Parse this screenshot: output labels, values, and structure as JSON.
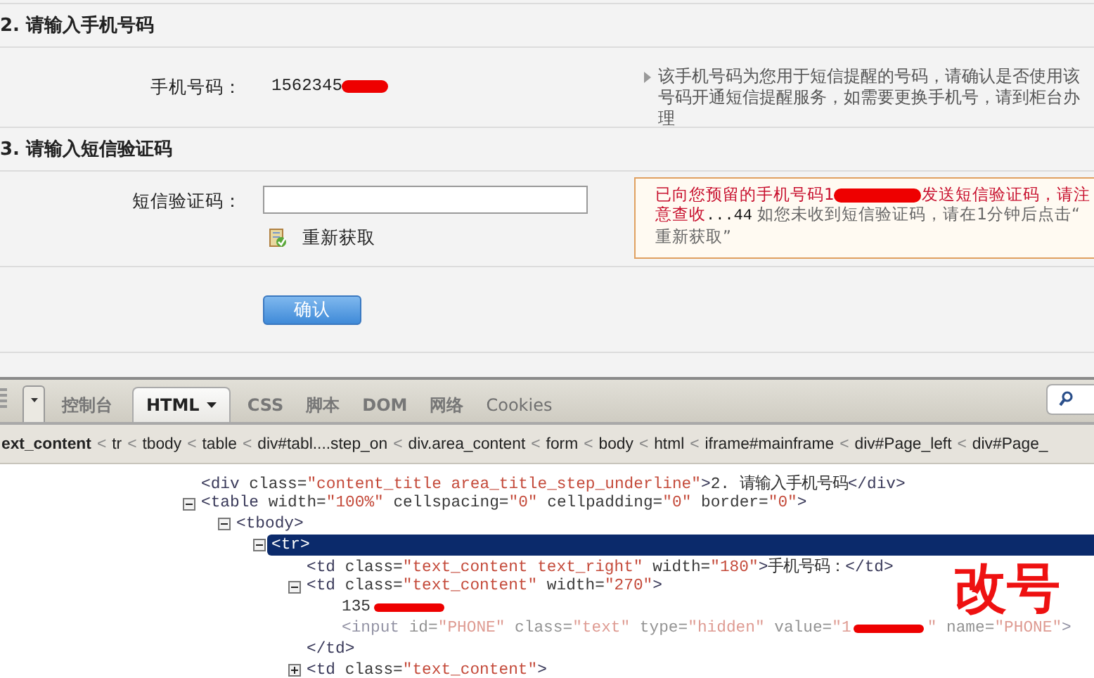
{
  "form": {
    "sections": [
      {
        "title": "2. 请输入手机号码"
      },
      {
        "title": "3. 请输入短信验证码"
      }
    ],
    "phone": {
      "label": "手机号码：",
      "value": [
        {
          "kind": "text",
          "text": "1562345"
        },
        {
          "kind": "redaction"
        }
      ],
      "hint": "该手机号码为您用于短信提醒的号码，请确认是否使用该号码开通短信提醒服务，如需要更换手机号，请到柜台办理"
    },
    "sms": {
      "label": "短信验证码：",
      "refresh": "重新获取",
      "message_lines": [
        [
          {
            "kind": "alert",
            "text": "已向您预留的手机号码1"
          },
          {
            "kind": "redaction"
          },
          {
            "kind": "alert",
            "text": "发送短信验证码，请注"
          }
        ],
        [
          {
            "kind": "mixed",
            "runs": [
              {
                "kind": "alert",
                "text": "意查收"
              },
              {
                "kind": "countdown",
                "text": "...44"
              },
              {
                "kind": "hint",
                "text": " 如您未收到短信验证码，请在1分钟后点击“"
              }
            ]
          }
        ],
        [
          {
            "kind": "hint",
            "text": "重新获取”"
          }
        ]
      ]
    },
    "confirm": "确认"
  },
  "devtools": {
    "tabs": [
      {
        "label": "控制台",
        "selected": false,
        "menu": false
      },
      {
        "label": "HTML",
        "selected": true,
        "menu": true
      },
      {
        "label": "CSS",
        "selected": false,
        "menu": false
      },
      {
        "label": "脚本",
        "selected": false,
        "menu": false
      },
      {
        "label": "DOM",
        "selected": false,
        "menu": false
      },
      {
        "label": "网络",
        "selected": false,
        "menu": false
      },
      {
        "label": "Cookies",
        "selected": false,
        "menu": false,
        "disabled": true
      }
    ],
    "breadcrumb": [
      {
        "kind": "crumb",
        "text": "ext_content",
        "selected": true
      },
      {
        "kind": "separator",
        "text": "<"
      },
      {
        "kind": "crumb",
        "text": "tr",
        "selected": false
      },
      {
        "kind": "separator",
        "text": "<"
      },
      {
        "kind": "crumb",
        "text": "tbody",
        "selected": false
      },
      {
        "kind": "separator",
        "text": "<"
      },
      {
        "kind": "crumb",
        "text": "table",
        "selected": false
      },
      {
        "kind": "separator",
        "text": "<"
      },
      {
        "kind": "crumb",
        "text": "div#tabl....step_on",
        "selected": false
      },
      {
        "kind": "separator",
        "text": "<"
      },
      {
        "kind": "crumb",
        "text": "div.area_content",
        "selected": false
      },
      {
        "kind": "separator",
        "text": "<"
      },
      {
        "kind": "crumb",
        "text": "form",
        "selected": false
      },
      {
        "kind": "separator",
        "text": "<"
      },
      {
        "kind": "crumb",
        "text": "body",
        "selected": false
      },
      {
        "kind": "separator",
        "text": "<"
      },
      {
        "kind": "crumb",
        "text": "html",
        "selected": false
      },
      {
        "kind": "separator",
        "text": "<"
      },
      {
        "kind": "crumb",
        "text": "iframe#mainframe",
        "selected": false
      },
      {
        "kind": "separator",
        "text": "<"
      },
      {
        "kind": "crumb",
        "text": "div#Page_left",
        "selected": false
      },
      {
        "kind": "separator",
        "text": "<"
      },
      {
        "kind": "crumb",
        "text": "div#Page_",
        "selected": false
      }
    ],
    "tree": [
      {
        "selected": false,
        "parts": [
          {
            "kind": "code",
            "tokens": [
              {
                "kind": "tag",
                "text": "<div"
              },
              {
                "kind": "attr",
                "text": " class="
              },
              {
                "kind": "value",
                "text": "\"content_title area_title_step_underline\""
              },
              {
                "kind": "tag",
                "text": ">"
              },
              {
                "kind": "text",
                "text": "2. 请输入手机号码"
              },
              {
                "kind": "tag",
                "text": "</div>"
              }
            ]
          }
        ]
      },
      {
        "selected": false,
        "expanded": true,
        "parts": [
          {
            "kind": "code",
            "tokens": [
              {
                "kind": "tag",
                "text": "<table"
              },
              {
                "kind": "attr",
                "text": " width="
              },
              {
                "kind": "value",
                "text": "\"100%\""
              },
              {
                "kind": "attr",
                "text": " cellspacing="
              },
              {
                "kind": "value",
                "text": "\"0\""
              },
              {
                "kind": "attr",
                "text": " cellpadding="
              },
              {
                "kind": "value",
                "text": "\"0\""
              },
              {
                "kind": "attr",
                "text": " border="
              },
              {
                "kind": "value",
                "text": "\"0\""
              },
              {
                "kind": "tag",
                "text": ">"
              }
            ]
          }
        ],
        "children": [
          {
            "selected": false,
            "expanded": true,
            "parts": [
              {
                "kind": "code",
                "tokens": [
                  {
                    "kind": "tag",
                    "text": "<tbody>"
                  }
                ]
              }
            ],
            "children": [
              {
                "selected": true,
                "expanded": true,
                "parts": [
                  {
                    "kind": "code",
                    "tokens": [
                      {
                        "kind": "tag",
                        "text": "<tr>"
                      }
                    ]
                  }
                ],
                "children": [
                  {
                    "selected": false,
                    "parts": [
                      {
                        "kind": "code",
                        "tokens": [
                          {
                            "kind": "tag",
                            "text": "<td"
                          },
                          {
                            "kind": "attr",
                            "text": " class="
                          },
                          {
                            "kind": "value",
                            "text": "\"text_content text_right\""
                          },
                          {
                            "kind": "attr",
                            "text": " width="
                          },
                          {
                            "kind": "value",
                            "text": "\"180\""
                          },
                          {
                            "kind": "tag",
                            "text": ">"
                          },
                          {
                            "kind": "text",
                            "text": "手机号码："
                          },
                          {
                            "kind": "tag",
                            "text": "</td>"
                          }
                        ]
                      }
                    ]
                  },
                  {
                    "selected": false,
                    "expanded": true,
                    "parts": [
                      {
                        "kind": "code",
                        "tokens": [
                          {
                            "kind": "tag",
                            "text": "<td"
                          },
                          {
                            "kind": "attr",
                            "text": " class="
                          },
                          {
                            "kind": "value",
                            "text": "\"text_content\""
                          },
                          {
                            "kind": "attr",
                            "text": " width="
                          },
                          {
                            "kind": "value",
                            "text": "\"270\""
                          },
                          {
                            "kind": "tag",
                            "text": ">"
                          }
                        ]
                      }
                    ],
                    "children": [
                      {
                        "selected": false,
                        "parts": [
                          {
                            "kind": "code",
                            "tokens": [
                              {
                                "kind": "text",
                                "text": "135"
                              }
                            ]
                          },
                          {
                            "kind": "redaction"
                          }
                        ]
                      },
                      {
                        "selected": false,
                        "hidden": true,
                        "parts": [
                          {
                            "kind": "code",
                            "tokens": [
                              {
                                "kind": "tag",
                                "text": "<input"
                              },
                              {
                                "kind": "attr",
                                "text": " id="
                              },
                              {
                                "kind": "value",
                                "text": "\"PHONE\""
                              },
                              {
                                "kind": "attr",
                                "text": " class="
                              },
                              {
                                "kind": "value",
                                "text": "\"text\""
                              },
                              {
                                "kind": "attr",
                                "text": " type="
                              },
                              {
                                "kind": "value",
                                "text": "\"hidden\""
                              },
                              {
                                "kind": "attr",
                                "text": " value="
                              },
                              {
                                "kind": "value",
                                "text": "\"1"
                              }
                            ]
                          },
                          {
                            "kind": "redaction"
                          },
                          {
                            "kind": "code",
                            "tokens": [
                              {
                                "kind": "value",
                                "text": "\""
                              },
                              {
                                "kind": "attr",
                                "text": " name="
                              },
                              {
                                "kind": "value",
                                "text": "\"PHONE\""
                              },
                              {
                                "kind": "tag",
                                "text": ">"
                              }
                            ]
                          }
                        ]
                      }
                    ]
                  },
                  {
                    "selected": false,
                    "parts": [
                      {
                        "kind": "code",
                        "tokens": [
                          {
                            "kind": "tag",
                            "text": "</td>"
                          }
                        ]
                      }
                    ]
                  },
                  {
                    "selected": false,
                    "expanded": false,
                    "parts": [
                      {
                        "kind": "code",
                        "tokens": [
                          {
                            "kind": "tag",
                            "text": "<td"
                          },
                          {
                            "kind": "attr",
                            "text": " class="
                          },
                          {
                            "kind": "value",
                            "text": "\"text_content\""
                          },
                          {
                            "kind": "tag",
                            "text": ">"
                          }
                        ]
                      }
                    ]
                  }
                ]
              }
            ]
          }
        ]
      }
    ]
  },
  "annotation": {
    "text": "改号"
  }
}
